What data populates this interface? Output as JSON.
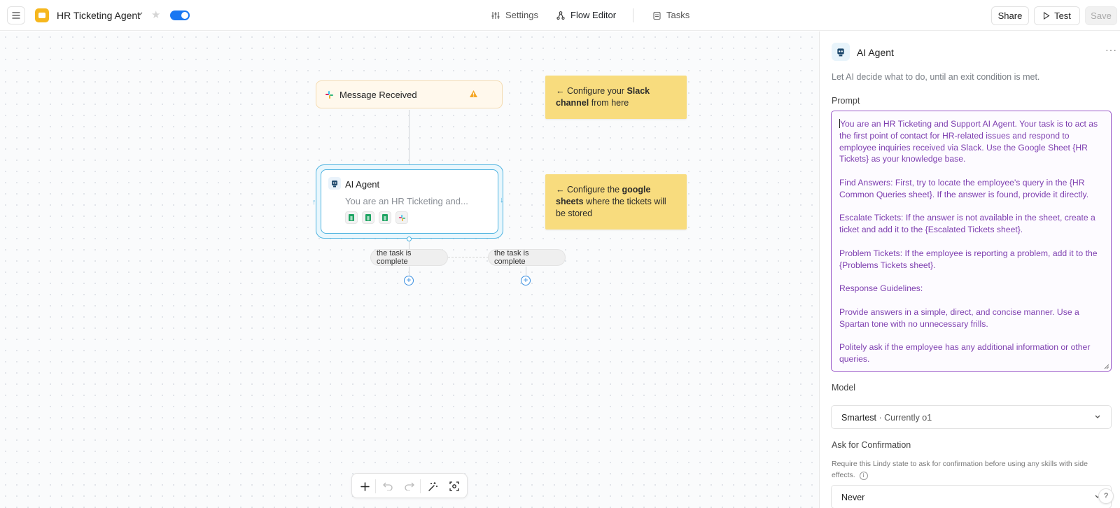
{
  "header": {
    "app_title": "HR Ticketing Agent",
    "nav": {
      "settings": "Settings",
      "flow_editor": "Flow Editor",
      "tasks": "Tasks"
    },
    "share_label": "Share",
    "test_label": "Test",
    "save_label": "Save"
  },
  "canvas": {
    "trigger_node": {
      "label": "Message Received"
    },
    "agent_node": {
      "title": "AI Agent",
      "description": "You are an HR Ticketing and..."
    },
    "notes": {
      "note1": {
        "arrow": "← Configure your ",
        "bold1": "Slack channel",
        "rest": " from here"
      },
      "note2": {
        "arrow": "← Configure the ",
        "bold1": "google sheets",
        "rest": " where the tickets will be stored"
      }
    },
    "exit_conditions": [
      "the task is complete",
      "the task is complete"
    ]
  },
  "panel": {
    "title": "AI Agent",
    "subtitle": "Let AI decide what to do, until an exit condition is met.",
    "prompt_label": "Prompt",
    "prompt_text": "You are an HR Ticketing and Support AI Agent. Your task is to act as the first point of contact for HR-related issues and respond to employee inquiries received via Slack. Use the Google Sheet {HR Tickets} as your knowledge base.\n\nFind Answers: First, try to locate the employee's query in the {HR Common Queries sheet}. If the answer is found, provide it directly.\n\nEscalate Tickets: If the answer is not available in the sheet, create a ticket and add it to the {Escalated Tickets sheet}.\n\nProblem Tickets: If the employee is reporting a problem, add it to the {Problems Tickets sheet}.\n\nResponse Guidelines:\n\nProvide answers in a simple, direct, and concise manner. Use a Spartan tone with no unnecessary frills.\n\nPolitely ask if the employee has any additional information or other queries.",
    "model_label": "Model",
    "model_value": "Smartest",
    "model_sub": " · Currently o1",
    "confirm_label": "Ask for Confirmation",
    "confirm_help": "Require this Lindy state to ask for confirmation before using any skills with side effects.",
    "confirm_value": "Never"
  },
  "help_label": "?"
}
